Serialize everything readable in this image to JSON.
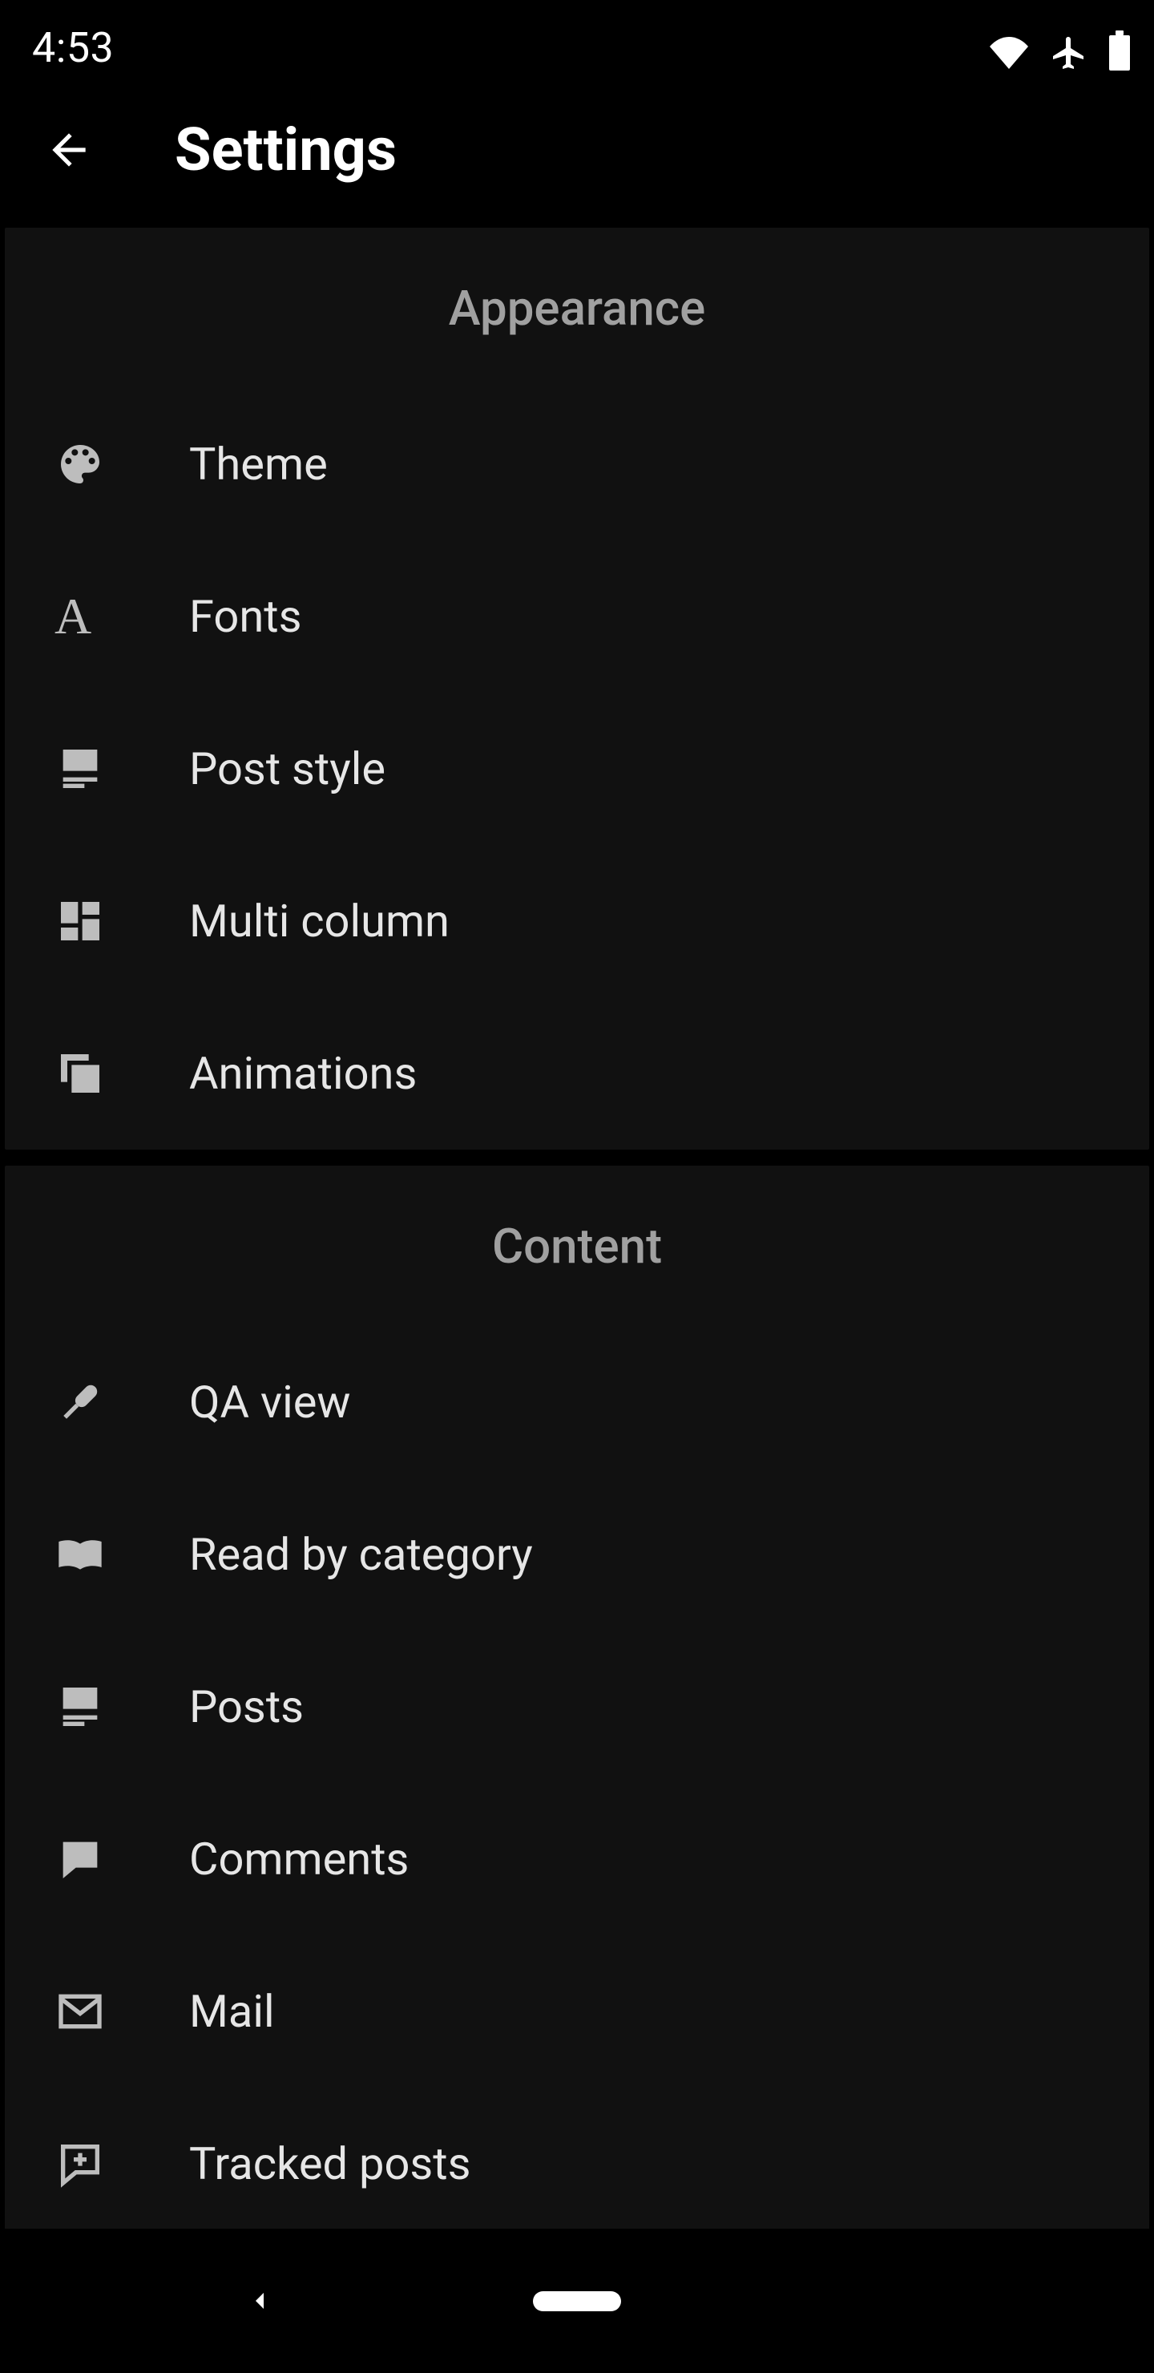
{
  "status": {
    "time": "4:53"
  },
  "appbar": {
    "title": "Settings"
  },
  "sections": [
    {
      "header": "Appearance",
      "items": [
        {
          "label": "Theme",
          "icon": "palette-icon"
        },
        {
          "label": "Fonts",
          "icon": "font-a-icon"
        },
        {
          "label": "Post style",
          "icon": "post-card-icon"
        },
        {
          "label": "Multi column",
          "icon": "dashboard-icon"
        },
        {
          "label": "Animations",
          "icon": "layers-icon"
        }
      ]
    },
    {
      "header": "Content",
      "items": [
        {
          "label": "QA view",
          "icon": "mic-icon"
        },
        {
          "label": "Read by category",
          "icon": "book-open-icon"
        },
        {
          "label": "Posts",
          "icon": "post-card-icon"
        },
        {
          "label": "Comments",
          "icon": "comment-icon"
        },
        {
          "label": "Mail",
          "icon": "mail-icon"
        },
        {
          "label": "Tracked posts",
          "icon": "comment-plus-icon"
        }
      ]
    }
  ]
}
